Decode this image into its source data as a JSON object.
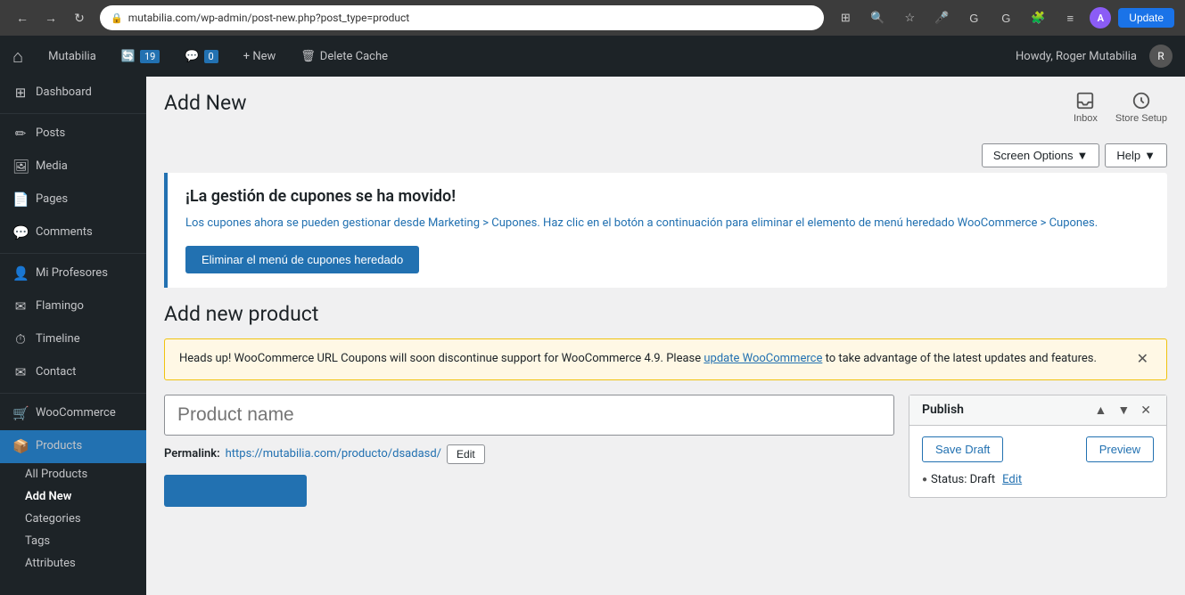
{
  "browser": {
    "url": "mutabilia.com/wp-admin/post-new.php?post_type=product",
    "update_label": "Update",
    "avatar_letter": "A"
  },
  "admin_bar": {
    "site_name": "Mutabilia",
    "updates_count": "19",
    "comments_count": "0",
    "new_label": "+ New",
    "delete_cache_label": "Delete Cache",
    "howdy_text": "Howdy, Roger Mutabilia"
  },
  "sidebar": {
    "items": [
      {
        "id": "dashboard",
        "label": "Dashboard",
        "icon": "⊞"
      },
      {
        "id": "posts",
        "label": "Posts",
        "icon": "✏"
      },
      {
        "id": "media",
        "label": "Media",
        "icon": "🖼"
      },
      {
        "id": "pages",
        "label": "Pages",
        "icon": "📄"
      },
      {
        "id": "comments",
        "label": "Comments",
        "icon": "💬"
      },
      {
        "id": "mi-profesores",
        "label": "Mi Profesores",
        "icon": "👤"
      },
      {
        "id": "flamingo",
        "label": "Flamingo",
        "icon": "✉"
      },
      {
        "id": "timeline",
        "label": "Timeline",
        "icon": "⏱"
      },
      {
        "id": "contact",
        "label": "Contact",
        "icon": "✉"
      },
      {
        "id": "woocommerce",
        "label": "WooCommerce",
        "icon": "🛒"
      },
      {
        "id": "products",
        "label": "Products",
        "icon": "📦",
        "active": true
      }
    ],
    "sub_items": [
      {
        "id": "all-products",
        "label": "All Products"
      },
      {
        "id": "add-new",
        "label": "Add New",
        "active": true
      },
      {
        "id": "categories",
        "label": "Categories"
      },
      {
        "id": "tags",
        "label": "Tags"
      },
      {
        "id": "attributes",
        "label": "Attributes"
      }
    ]
  },
  "page_header": {
    "title": "Add New",
    "inbox_label": "Inbox",
    "store_setup_label": "Store Setup",
    "screen_options_label": "Screen Options",
    "help_label": "Help"
  },
  "coupon_notice": {
    "title": "¡La gestión de cupones se ha movido!",
    "text": "Los cupones ahora se pueden gestionar desde Marketing > Cupones. Haz clic en el botón a continuación para eliminar el elemento de menú heredado WooCommerce > Cupones.",
    "button_label": "Eliminar el menú de cupones heredado"
  },
  "product_section": {
    "title": "Add new product",
    "warning_text_before": "Heads up! WooCommerce URL Coupons will soon discontinue support for WooCommerce 4.9. Please ",
    "warning_link_text": "update WooCommerce",
    "warning_text_after": " to take advantage of the latest updates and features.",
    "product_name_placeholder": "Product name",
    "permalink_label": "Permalink:",
    "permalink_url": "https://mutabilia.com/producto/dsadasd/",
    "edit_label": "Edit"
  },
  "publish_box": {
    "title": "Publish",
    "save_draft_label": "Save Draft",
    "preview_label": "Preview",
    "status_label": "Status: Draft",
    "edit_status_label": "Edit"
  }
}
